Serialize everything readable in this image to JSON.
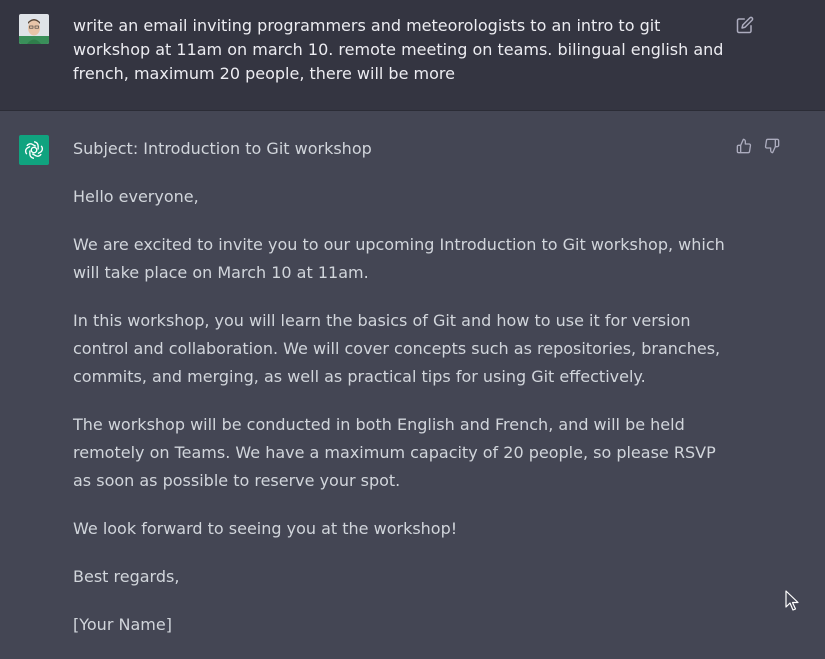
{
  "conversation": {
    "user_message": "write an email inviting programmers and meteorologists to an intro to git workshop at 11am on march 10. remote meeting on teams. bilingual english and french, maximum 20 people, there will be more",
    "response": {
      "subject": "Subject: Introduction to Git workshop",
      "greeting": "Hello everyone,",
      "paragraph1": "We are excited to invite you to our upcoming Introduction to Git workshop, which will take place on March 10 at 11am.",
      "paragraph2": "In this workshop, you will learn the basics of Git and how to use it for version control and collaboration. We will cover concepts such as repositories, branches, commits, and merging, as well as practical tips for using Git effectively.",
      "paragraph3": "The workshop will be conducted in both English and French, and will be held remotely on Teams. We have a maximum capacity of 20 people, so please RSVP as soon as possible to reserve your spot.",
      "closing_line": "We look forward to seeing you at the workshop!",
      "sign_off": "Best regards,",
      "signature": "[Your Name]"
    }
  },
  "icons": {
    "user_avatar": "user-photo-avatar",
    "bot_avatar": "openai-logo",
    "edit": "pencil-square-icon",
    "thumbs_up": "thumbs-up-icon",
    "thumbs_down": "thumbs-down-icon",
    "pointer": "mouse-cursor-icon"
  },
  "colors": {
    "user_bg": "#343541",
    "assistant_bg": "#444654",
    "bot_avatar_bg": "#10a37f",
    "text_primary": "#ececf1",
    "text_secondary": "#d1d5db",
    "icon_gray": "#acacbe"
  }
}
